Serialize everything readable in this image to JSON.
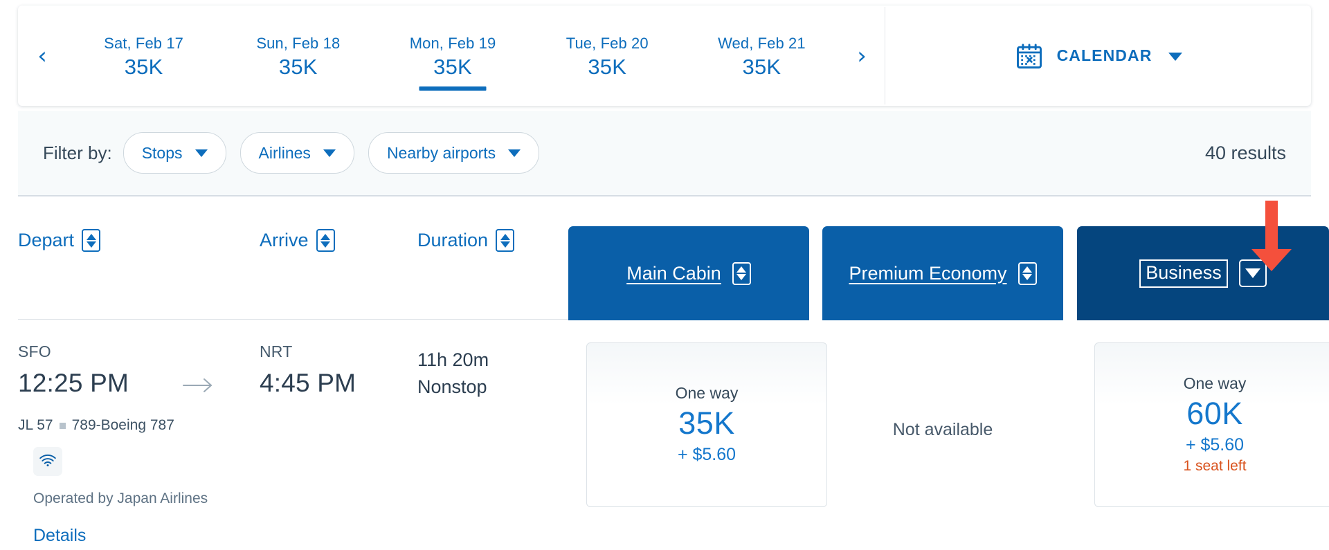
{
  "date_strip": {
    "prev_label": "‹",
    "next_label": "›",
    "days": [
      {
        "label": "Sat, Feb 17",
        "price": "35K",
        "selected": false
      },
      {
        "label": "Sun, Feb 18",
        "price": "35K",
        "selected": false
      },
      {
        "label": "Mon, Feb 19",
        "price": "35K",
        "selected": true
      },
      {
        "label": "Tue, Feb 20",
        "price": "35K",
        "selected": false
      },
      {
        "label": "Wed, Feb 21",
        "price": "35K",
        "selected": false
      }
    ],
    "calendar": {
      "label": "CALENDAR",
      "icon": "calendar-icon"
    }
  },
  "filter_bar": {
    "label": "Filter by:",
    "chips": [
      {
        "label": "Stops"
      },
      {
        "label": "Airlines"
      },
      {
        "label": "Nearby airports"
      }
    ],
    "results": "40 results"
  },
  "results_header": {
    "depart": "Depart",
    "arrive": "Arrive",
    "duration": "Duration",
    "cabins": [
      {
        "label": "Main Cabin",
        "style": "light"
      },
      {
        "label": "Premium Economy",
        "style": "light"
      },
      {
        "label": "Business",
        "style": "dark"
      }
    ]
  },
  "flight": {
    "depart_airport": "SFO",
    "depart_time": "12:25 PM",
    "arrive_airport": "NRT",
    "arrive_time": "4:45 PM",
    "duration": "11h 20m",
    "stops": "Nonstop",
    "flight_number": "JL 57",
    "aircraft": "789-Boeing 787",
    "amenity_icon": "wifi-icon",
    "operated_by": "Operated by Japan Airlines",
    "details_link": "Details",
    "fares": {
      "main_cabin": {
        "trip_type": "One way",
        "miles": "35K",
        "fee": "+ $5.60",
        "seats_left": ""
      },
      "premium_economy": {
        "status": "Not available"
      },
      "business": {
        "trip_type": "One way",
        "miles": "60K",
        "fee": "+ $5.60",
        "seats_left": "1 seat left"
      }
    }
  },
  "colors": {
    "link_blue": "#0d6dbc",
    "cabin_blue": "#0a5fa8",
    "business_navy": "#05457e",
    "alert_orange": "#d9531e",
    "annotation_red": "#f4503c",
    "text_slate": "#36495a"
  }
}
